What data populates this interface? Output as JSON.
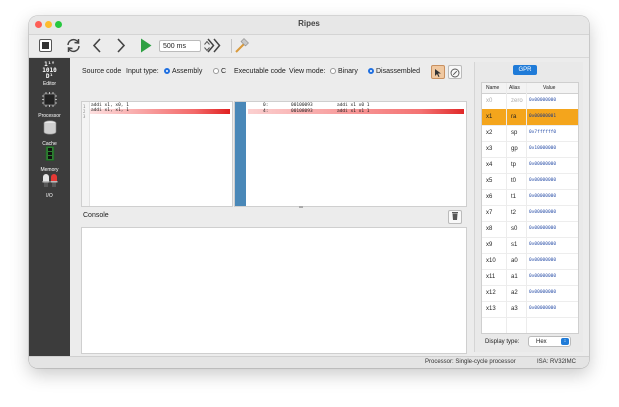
{
  "window": {
    "title": "Ripes"
  },
  "toolbar": {
    "delay_value": "500 ms"
  },
  "sidebar": {
    "items": [
      {
        "label": "Editor",
        "icon": "editor-binary-icon",
        "glyph": "1¹°\n1010\nD¹"
      },
      {
        "label": "Processor",
        "icon": "processor-chip-icon"
      },
      {
        "label": "Cache",
        "icon": "cache-cylinder-icon"
      },
      {
        "label": "Memory",
        "icon": "memory-ram-icon"
      },
      {
        "label": "I/O",
        "icon": "io-led-icon"
      }
    ]
  },
  "source": {
    "title": "Source code",
    "input_type_label": "Input type:",
    "options": [
      "Assembly",
      "C"
    ],
    "selected": "Assembly",
    "lines": [
      {
        "n": "1",
        "text": "addi x1, x0, 1"
      },
      {
        "n": "2",
        "text": "addi x1, x1, 1"
      },
      {
        "n": "3",
        "text": ""
      }
    ]
  },
  "executable": {
    "title": "Executable code",
    "view_mode_label": "View mode:",
    "options": [
      "Binary",
      "Disassembled"
    ],
    "selected": "Disassembled",
    "lines": [
      {
        "addr": "0:",
        "hex": "00100093",
        "asm": "addi x1 x0 1"
      },
      {
        "addr": "4:",
        "hex": "00108093",
        "asm": "addi x1 x1 1"
      }
    ]
  },
  "console": {
    "title": "Console"
  },
  "gpr": {
    "tab": "GPR",
    "headers": [
      "Name",
      "Alias",
      "Value"
    ],
    "rows": [
      {
        "name": "x0",
        "alias": "zero",
        "value": "0x00000000"
      },
      {
        "name": "x1",
        "alias": "ra",
        "value": "0x00000001"
      },
      {
        "name": "x2",
        "alias": "sp",
        "value": "0x7ffffff0"
      },
      {
        "name": "x3",
        "alias": "gp",
        "value": "0x10000000"
      },
      {
        "name": "x4",
        "alias": "tp",
        "value": "0x00000000"
      },
      {
        "name": "x5",
        "alias": "t0",
        "value": "0x00000000"
      },
      {
        "name": "x6",
        "alias": "t1",
        "value": "0x00000000"
      },
      {
        "name": "x7",
        "alias": "t2",
        "value": "0x00000000"
      },
      {
        "name": "x8",
        "alias": "s0",
        "value": "0x00000000"
      },
      {
        "name": "x9",
        "alias": "s1",
        "value": "0x00000000"
      },
      {
        "name": "x10",
        "alias": "a0",
        "value": "0x00000000"
      },
      {
        "name": "x11",
        "alias": "a1",
        "value": "0x00000000"
      },
      {
        "name": "x12",
        "alias": "a2",
        "value": "0x00000000"
      },
      {
        "name": "x13",
        "alias": "a3",
        "value": "0x00000000"
      }
    ],
    "selected_row": "x1",
    "display_type_label": "Display type:",
    "display_type_value": "Hex"
  },
  "status": {
    "processor": "Processor: Single-cycle processor",
    "isa": "ISA: RV32IMC"
  },
  "colors": {
    "accent": "#1f7bd8",
    "selection": "#f4a51c",
    "sidebar": "#3c3c3c",
    "highlight": "#e02020",
    "run": "#2ea043"
  }
}
